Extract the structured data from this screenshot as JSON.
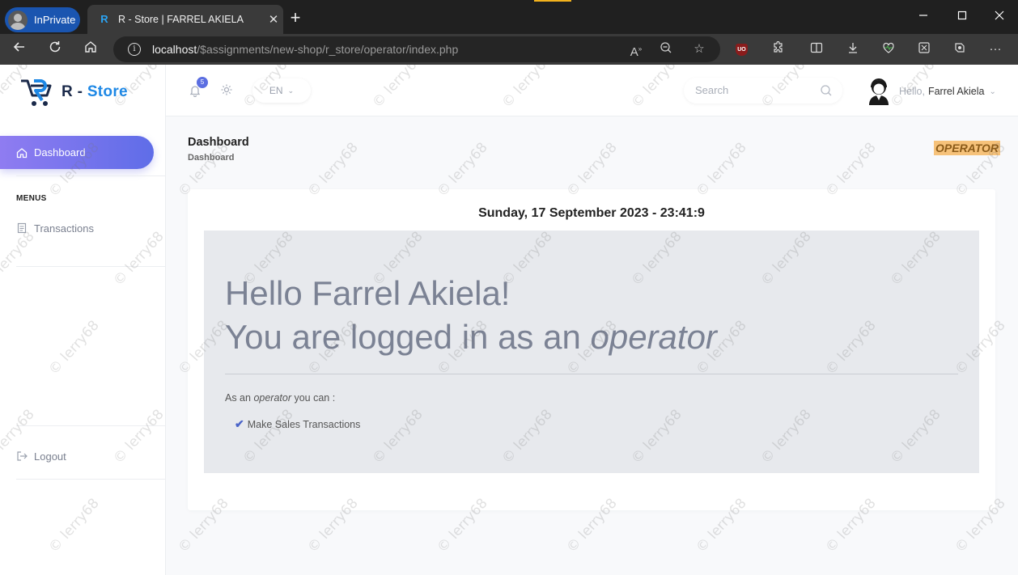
{
  "browser": {
    "inprivate_label": "InPrivate",
    "tab_title": "R - Store | FARREL AKIELA",
    "tab_close": "✕",
    "new_tab": "+",
    "url_host": "localhost",
    "url_path": "/$assignments/new-shop/r_store/operator/index.php",
    "window_controls": [
      "minimize",
      "maximize",
      "close"
    ],
    "icons": [
      "back-icon",
      "refresh-icon",
      "home-icon",
      "info-icon",
      "read-aloud-icon",
      "zoom-out-icon",
      "favorite-icon",
      "ublock-icon",
      "extensions-icon",
      "split-screen-icon",
      "downloads-icon",
      "browser-essentials-icon",
      "web-capture-icon",
      "copilot-icon",
      "more-icon"
    ],
    "ublock_label": "UO"
  },
  "app": {
    "brand_prefix": "R - ",
    "brand_name": "Store",
    "accent_color": "#6574e9",
    "sidebar": {
      "dashboard_label": "Dashboard",
      "menus_label": "MENUS",
      "transactions_label": "Transactions",
      "logout_label": "Logout"
    },
    "topbar": {
      "notification_count": "5",
      "language": "EN",
      "search_placeholder": "Search",
      "hello": "Hello,",
      "user_name": "Farrel Akiela"
    },
    "header": {
      "title": "Dashboard",
      "breadcrumb": "Dashboard",
      "role_badge": "OPERATOR"
    },
    "card": {
      "datetime": "Sunday, 17 September 2023 - 23:41:9",
      "greeting": "Hello Farrel Akiela!",
      "logged_in_prefix": "You are logged in as an ",
      "role": "operator",
      "can_prefix": "As an ",
      "can_suffix": " you can :",
      "permissions": [
        "Make Sales Transactions"
      ]
    },
    "watermark_text": "© lerry68"
  }
}
